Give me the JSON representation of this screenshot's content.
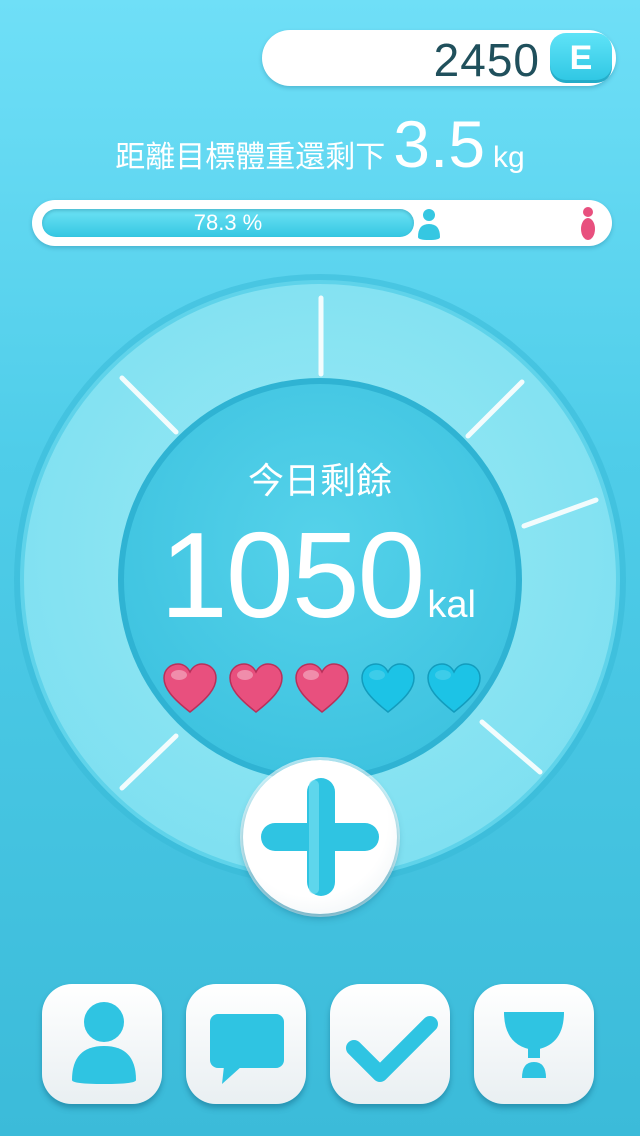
{
  "energy": {
    "value": "2450",
    "badge": "E"
  },
  "goal": {
    "prefix": "距離目標體重還剩下",
    "number": "3.5",
    "unit": "kg"
  },
  "progress": {
    "percent": 78.3,
    "label": "78.3 %"
  },
  "today": {
    "label": "今日剩餘",
    "value": "1050",
    "unit": "kal"
  },
  "hearts": {
    "total": 5,
    "filled": 3
  },
  "colors": {
    "accent": "#35c7e2",
    "heart_full": "#e8507e",
    "heart_empty": "#1cc3e6",
    "text_dark": "#20505c"
  },
  "nav": {
    "items": [
      {
        "icon": "profile-icon"
      },
      {
        "icon": "chat-icon"
      },
      {
        "icon": "checkmark-icon"
      },
      {
        "icon": "trophy-icon"
      }
    ]
  },
  "add_button": {
    "icon": "plus-icon"
  }
}
